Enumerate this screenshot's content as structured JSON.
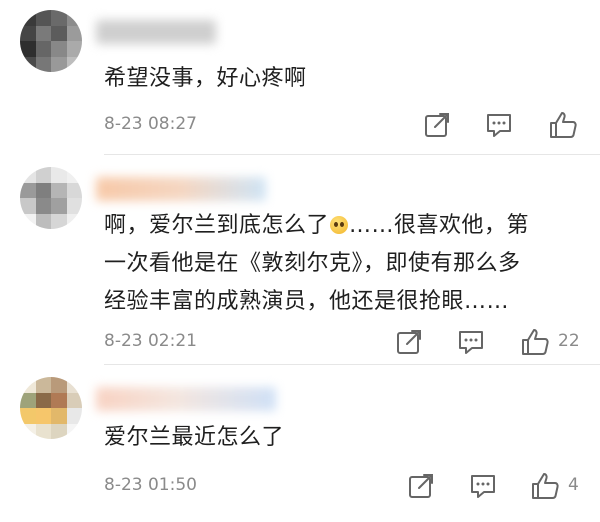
{
  "comments": [
    {
      "text_lines": [
        "希望没事，好心疼啊"
      ],
      "date": "8-23 08:27",
      "likes": ""
    },
    {
      "text_lines": [
        "啊，爱尔兰到底怎么了",
        "……很喜欢他，第",
        "一次看他是在《敦刻尔克》，即使有那么多",
        "经验丰富的成熟演员，他还是很抢眼……"
      ],
      "date": "8-23 02:21",
      "likes": "22"
    },
    {
      "text_lines": [
        "爱尔兰最近怎么了"
      ],
      "date": "8-23 01:50",
      "likes": "4"
    }
  ],
  "icons": [
    "share-icon",
    "comment-icon",
    "like-icon"
  ],
  "colors": {
    "text": "#1f1f1f",
    "meta": "#8a8a8a",
    "divider": "#e6e6e6"
  }
}
